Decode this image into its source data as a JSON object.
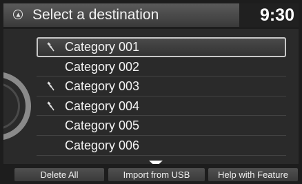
{
  "header": {
    "title": "Select a destination",
    "clock": "9:30",
    "icon": "home-icon"
  },
  "list": {
    "items": [
      {
        "label": "Category 001",
        "has_icon": true,
        "selected": true
      },
      {
        "label": "Category 002",
        "has_icon": false,
        "selected": false
      },
      {
        "label": "Category 003",
        "has_icon": true,
        "selected": false
      },
      {
        "label": "Category 004",
        "has_icon": true,
        "selected": false
      },
      {
        "label": "Category 005",
        "has_icon": false,
        "selected": false
      },
      {
        "label": "Category 006",
        "has_icon": false,
        "selected": false
      }
    ],
    "item_icon": "category-flag-icon",
    "scroll_icon": "scroll-down-icon"
  },
  "bottom_bar": {
    "delete_all": "Delete All",
    "import_usb": "Import from USB",
    "help": "Help with Feature"
  }
}
